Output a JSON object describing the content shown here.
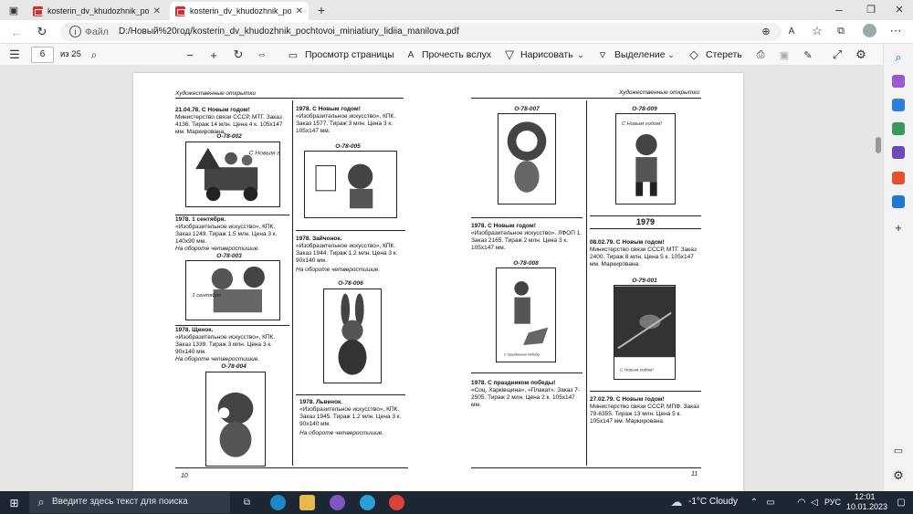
{
  "tabs": [
    {
      "title": "kosterin_dv_khudozhnik_pochtovo"
    },
    {
      "title": "kosterin_dv_khudozhnik_pochtovo"
    }
  ],
  "address": {
    "prefix": "Файл",
    "url": "D:/Новый%20год/kosterin_dv_khudozhnik_pochtovoi_miniatiury_lidiia_manilova.pdf"
  },
  "pdf_toolbar": {
    "page": "6",
    "of": "из 25",
    "view": "Просмотр страницы",
    "read": "Прочесть вслух",
    "draw": "Нарисовать",
    "highlight": "Выделение",
    "erase": "Стереть"
  },
  "left_page": {
    "header": "Художественные открытки",
    "c1": [
      "21.04.78. С Новым годом!",
      "Министерство связи СССР, МТГ. Заказ 4136. Тираж 14 млн. Цена 4 к. 105x147 мм. Маркирована.",
      "О-78-002",
      "1978. 1 сентября.",
      "«Изобразительное искусство», КПК. Заказ 1249. Тираж 1.5 млн. Цена 3 к. 140x90 мм.",
      "На обороте четверостишие.",
      "О-78-003",
      "1978. Щенок.",
      "«Изобразительное искусство», КПК. Заказ 1339. Тираж 3 млн. Цена 3 к. 90x140 мм.",
      "На обороте четверостишие.",
      "О-78-004"
    ],
    "c2": [
      "1978. С Новым годом!",
      "«Изобразительное искусство», КПК. Заказ 1577. Тираж 3 млн. Цена 3 к. 105x147 мм.",
      "О-78-005",
      "1978. Зайчонок.",
      "«Изобразительное искусство», КПК. Заказ 1944. Тираж 1.2 млн. Цена 3 к. 90x140 мм.",
      "На обороте четверостишие.",
      "О-78-006",
      "1978. Львенок.",
      "«Изобразительное искусство», КПК. Заказ 1945. Тираж 1.2 млн. Цена 3 к. 90x140 мм.",
      "На обороте четверостишие."
    ],
    "page_no": "10"
  },
  "right_page": {
    "header": "Художественные открытки",
    "c1": [
      "О-78-007",
      "1978. С Новым годом!",
      "«Изобразительное искусство». ЛФОП 1. Заказ 2165. Тираж 2 млн. Цена 3 к. 105x147 мм.",
      "О-78-008",
      "1978. С праздником победы!",
      "«Соц. Харківщина», «Плакат». Заказ 7-2505. Тираж 2 млн. Цена 2 к. 105x147 мм."
    ],
    "c2": [
      "О-78-009",
      "1979",
      "08.02.79. С Новым годом!",
      "Министерство связи СССР, МТГ. Заказ 2400. Тираж 8 млн. Цена 5 к. 105x147 мм. Маркирована.",
      "О-79-001",
      "27.02.79. С Новым годом!",
      "Министерство связи СССР, МПФ. Заказ 79-6355. Тираж 13 млн. Цена 5 к. 105x147 мм. Маркирована."
    ],
    "page_no": "11"
  },
  "card_texts": {
    "new_year": "С Новым годом!",
    "sept": "1 сентября",
    "victory": "С праздником победы"
  },
  "taskbar": {
    "search": "Введите здесь текст для поиска",
    "weather": "-1°C Cloudy",
    "lang": "РУС",
    "time": "12:01",
    "date": "10.01.2023"
  },
  "colors": {
    "accent": "#0f6cbd",
    "pdf_red": "#d32f2f",
    "taskbar": "#1c2733"
  }
}
